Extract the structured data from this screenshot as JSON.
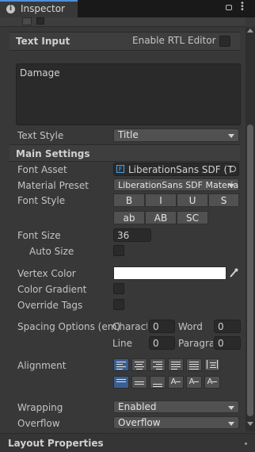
{
  "tab": {
    "title": "Inspector"
  },
  "text_input": {
    "header": "Text Input",
    "rtl_label": "Enable RTL Editor",
    "value": "Damage"
  },
  "text_style": {
    "label": "Text Style",
    "value": "Title"
  },
  "main_settings": {
    "header": "Main Settings"
  },
  "font_asset": {
    "label": "Font Asset",
    "value": "LiberationSans SDF (T"
  },
  "material_preset": {
    "label": "Material Preset",
    "value": "LiberationSans SDF Materia"
  },
  "font_style": {
    "label": "Font Style",
    "buttons": [
      "B",
      "I",
      "U",
      "S",
      "ab",
      "AB",
      "SC"
    ]
  },
  "font_size": {
    "label": "Font Size",
    "value": "36"
  },
  "auto_size": {
    "label": "Auto Size"
  },
  "vertex_color": {
    "label": "Vertex Color",
    "color": "#ffffff"
  },
  "color_gradient": {
    "label": "Color Gradient"
  },
  "override_tags": {
    "label": "Override Tags"
  },
  "spacing": {
    "label": "Spacing Options (em)",
    "character_label": "Charact",
    "character_value": "0",
    "word_label": "Word",
    "word_value": "0",
    "line_label": "Line",
    "line_value": "0",
    "paragraph_label": "Paragra",
    "paragraph_value": "0"
  },
  "alignment": {
    "label": "Alignment"
  },
  "wrapping": {
    "label": "Wrapping",
    "value": "Enabled"
  },
  "overflow": {
    "label": "Overflow",
    "value": "Overflow"
  },
  "layout_properties": {
    "header": "Layout Properties"
  },
  "colors": {
    "accent": "#3a5f91",
    "panel": "#383838",
    "header": "#3e3e3e"
  }
}
